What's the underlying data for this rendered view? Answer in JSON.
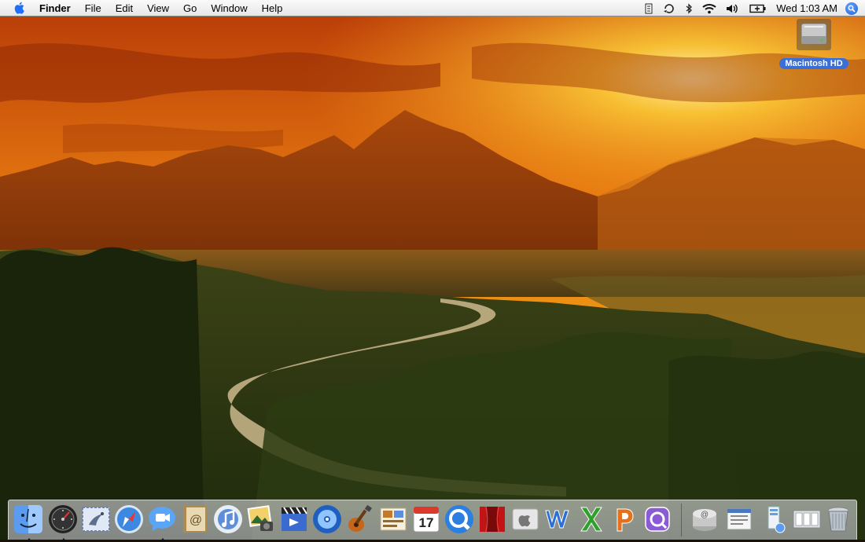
{
  "menubar": {
    "app_name": "Finder",
    "menus": [
      "File",
      "Edit",
      "View",
      "Go",
      "Window",
      "Help"
    ],
    "status_icons": [
      "script-icon",
      "sync-icon",
      "bluetooth-icon",
      "wifi-icon",
      "volume-icon",
      "battery-icon"
    ],
    "clock": "Wed 1:03 AM"
  },
  "desktop": {
    "icons": [
      {
        "label": "Macintosh HD",
        "icon": "hard-drive-icon"
      }
    ]
  },
  "dock": {
    "apps": [
      {
        "name": "finder-icon",
        "running": true
      },
      {
        "name": "dashboard-icon",
        "running": true
      },
      {
        "name": "mail-icon",
        "running": false
      },
      {
        "name": "safari-icon",
        "running": false
      },
      {
        "name": "ichat-icon",
        "running": true
      },
      {
        "name": "address-book-icon",
        "running": false
      },
      {
        "name": "itunes-icon",
        "running": false
      },
      {
        "name": "iphoto-icon",
        "running": false
      },
      {
        "name": "imovie-icon",
        "running": false
      },
      {
        "name": "idvd-icon",
        "running": false
      },
      {
        "name": "garageband-icon",
        "running": false
      },
      {
        "name": "iweb-icon",
        "running": false
      },
      {
        "name": "ical-icon",
        "running": false,
        "label": "17"
      },
      {
        "name": "quicktime-icon",
        "running": false
      },
      {
        "name": "front-row-icon",
        "running": false
      },
      {
        "name": "apple-logo-icon",
        "running": false
      },
      {
        "name": "word-icon",
        "running": false
      },
      {
        "name": "excel-icon",
        "running": false
      },
      {
        "name": "powerpoint-icon",
        "running": false
      },
      {
        "name": "entourage-icon",
        "running": false
      },
      {
        "name": "mail-server-icon",
        "running": false
      },
      {
        "name": "document-icon",
        "running": false
      },
      {
        "name": "system-profiler-icon",
        "running": false
      },
      {
        "name": "preview-icon",
        "running": false
      },
      {
        "name": "trash-icon",
        "running": false
      }
    ]
  },
  "colors": {
    "sky_top": "#c33a07",
    "sky_glow": "#ffd23a",
    "mountains": "#8c3d0a",
    "forest": "#2b3512",
    "river": "#d8c79f",
    "selection": "#3a6fd8"
  }
}
